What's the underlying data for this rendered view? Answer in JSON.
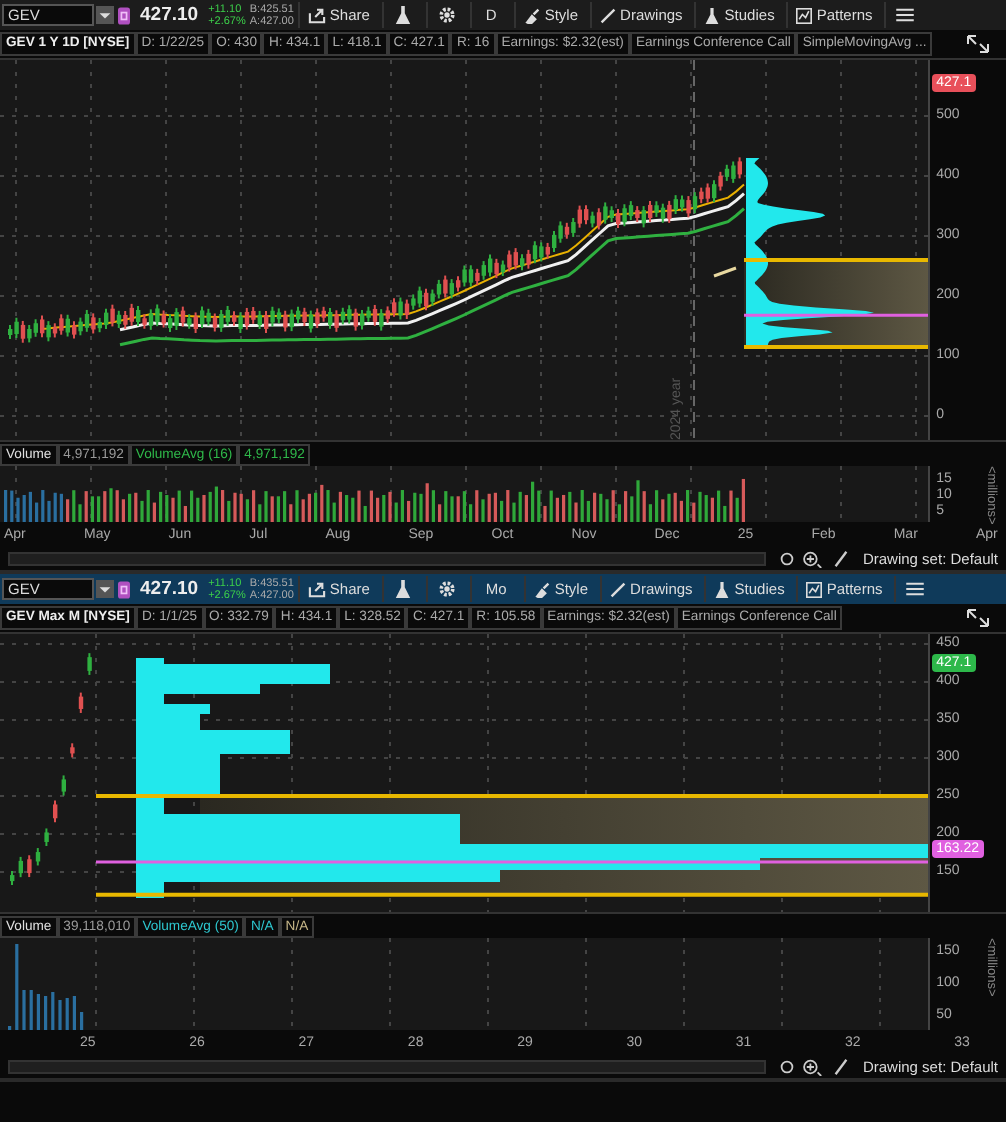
{
  "panels": [
    {
      "kind": "daily",
      "active": false,
      "toolbar": {
        "symbol": "GEV",
        "price": "427.10",
        "change": "+11.10",
        "change_pct": "+2.67%",
        "bid": "B:425.51",
        "ask": "A:427.00",
        "share": "Share",
        "aggregation": "D",
        "style": "Style",
        "drawings": "Drawings",
        "studies": "Studies",
        "patterns": "Patterns"
      },
      "header": {
        "title": "GEV 1 Y 1D [NYSE]",
        "fields": [
          "D: 1/22/25",
          "O: 430",
          "H: 434.1",
          "L: 418.1",
          "C: 427.1",
          "R: 16",
          "Earnings: $2.32(est)",
          "Earnings Conference Call",
          "SimpleMovingAvg ..."
        ]
      },
      "price_axis": [
        "500",
        "400",
        "300",
        "200",
        "100",
        "0"
      ],
      "price_markers": [
        {
          "text": "427.1",
          "color": "#e8505a"
        }
      ],
      "year_label": "2024 year",
      "volume_header": [
        {
          "text": "Volume",
          "kind": "label"
        },
        {
          "text": "4,971,192",
          "kind": "value"
        },
        {
          "text": "VolumeAvg (16)",
          "kind": "average_green"
        },
        {
          "text": "4,971,192",
          "kind": "average_green"
        }
      ],
      "volume_axis": [
        "15",
        "10",
        "5"
      ],
      "volume_unit": "<millions>",
      "x_axis": [
        "Apr",
        "May",
        "Jun",
        "Jul",
        "Aug",
        "Sep",
        "Oct",
        "Nov",
        "Dec",
        "25",
        "Feb",
        "Mar",
        "Apr"
      ],
      "drawing_set": "Drawing set: Default"
    },
    {
      "kind": "monthly",
      "active": true,
      "toolbar": {
        "symbol": "GEV",
        "price": "427.10",
        "change": "+11.10",
        "change_pct": "+2.67%",
        "bid": "B:435.51",
        "ask": "A:427.00",
        "share": "Share",
        "aggregation": "Mo",
        "style": "Style",
        "drawings": "Drawings",
        "studies": "Studies",
        "patterns": "Patterns"
      },
      "header": {
        "title": "GEV Max M [NYSE]",
        "fields": [
          "D: 1/1/25",
          "O: 332.79",
          "H: 434.1",
          "L: 328.52",
          "C: 427.1",
          "R: 105.58",
          "Earnings: $2.32(est)",
          "Earnings Conference Call"
        ]
      },
      "price_axis": [
        "450",
        "400",
        "350",
        "300",
        "250",
        "200",
        "150"
      ],
      "price_markers": [
        {
          "text": "427.1",
          "color": "#2db84a"
        },
        {
          "text": "163.22",
          "color": "#e060e0"
        }
      ],
      "volume_header": [
        {
          "text": "Volume",
          "kind": "label"
        },
        {
          "text": "39,118,010",
          "kind": "value"
        },
        {
          "text": "VolumeAvg (50)",
          "kind": "average_cyan"
        },
        {
          "text": "N/A",
          "kind": "average_cyan"
        },
        {
          "text": "N/A",
          "kind": "average_tan"
        }
      ],
      "volume_axis": [
        "150",
        "100",
        "50"
      ],
      "volume_unit": "<millions>",
      "x_axis": [
        "25",
        "26",
        "27",
        "28",
        "29",
        "30",
        "31",
        "32",
        "33"
      ],
      "drawing_set": "Drawing set: Default"
    }
  ]
}
